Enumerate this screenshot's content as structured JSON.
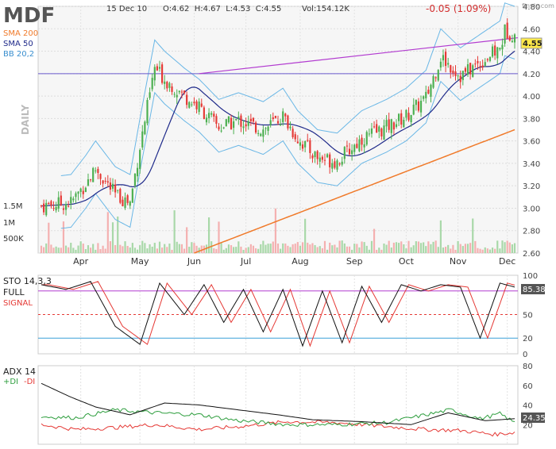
{
  "header": {
    "ticker": "MDF",
    "date": "15 Dec 10",
    "ohlc": "O:4.62  H:4.67  L:4.53  C:4.55",
    "volume": "Vol:154.12K",
    "change": "-0.05 (1.09%)",
    "brand": "finviz.com",
    "period": "DAILY"
  },
  "legend": {
    "sma200": "SMA 200",
    "sma50": "SMA 50",
    "bb": "BB 20,2"
  },
  "colors": {
    "up": "#4caf50",
    "down": "#e53935",
    "sma200": "#f07a2a",
    "sma50": "#1f2a8a",
    "bb": "#6ab7e6",
    "trend": "#b23bd0",
    "hline": "#6a5acd",
    "stoK": "#111111",
    "stoD": "#e53935",
    "adx": "#111111",
    "pdi": "#2e9e3e",
    "mdi": "#e53935"
  },
  "chart_data": [
    {
      "type": "candlestick",
      "title": "MDF",
      "months": [
        "Apr",
        "May",
        "Jun",
        "Jul",
        "Aug",
        "Sep",
        "Oct",
        "Nov",
        "Dec"
      ],
      "price_ticks": [
        2.6,
        2.8,
        3.0,
        3.2,
        3.4,
        3.6,
        3.8,
        4.0,
        4.2,
        4.4,
        4.6,
        4.8
      ],
      "ylim": [
        2.6,
        4.8
      ],
      "last_price": 4.55,
      "volume_ticks": [
        "1.5M",
        "1M",
        "500K"
      ],
      "close_path": [
        [
          0,
          3.02
        ],
        [
          12,
          3.05
        ],
        [
          18,
          3.22
        ],
        [
          22,
          3.35
        ],
        [
          30,
          3.12
        ],
        [
          36,
          3.05
        ],
        [
          40,
          3.55
        ],
        [
          46,
          4.25
        ],
        [
          50,
          4.15
        ],
        [
          58,
          4.0
        ],
        [
          64,
          3.9
        ],
        [
          72,
          3.72
        ],
        [
          80,
          3.78
        ],
        [
          90,
          3.7
        ],
        [
          98,
          3.82
        ],
        [
          104,
          3.62
        ],
        [
          112,
          3.45
        ],
        [
          120,
          3.42
        ],
        [
          130,
          3.62
        ],
        [
          140,
          3.72
        ],
        [
          148,
          3.82
        ],
        [
          156,
          3.98
        ],
        [
          162,
          4.35
        ],
        [
          170,
          4.18
        ],
        [
          178,
          4.3
        ],
        [
          186,
          4.42
        ],
        [
          188,
          4.58
        ],
        [
          192,
          4.55
        ]
      ],
      "sma200_endpoints": [
        [
          2.6,
          "Jun"
        ],
        [
          3.7,
          "Dec"
        ]
      ],
      "hline": 4.2
    },
    {
      "type": "line",
      "title": "STO 14,3,3",
      "labels": [
        "FULL",
        "SIGNAL"
      ],
      "y_ticks": [
        100,
        80,
        50,
        20,
        0
      ],
      "ylim": [
        0,
        100
      ],
      "last": "85.38",
      "k_path": [
        [
          0,
          88
        ],
        [
          10,
          82
        ],
        [
          20,
          92
        ],
        [
          30,
          35
        ],
        [
          40,
          12
        ],
        [
          48,
          90
        ],
        [
          58,
          50
        ],
        [
          66,
          88
        ],
        [
          74,
          40
        ],
        [
          82,
          82
        ],
        [
          90,
          28
        ],
        [
          98,
          82
        ],
        [
          106,
          10
        ],
        [
          114,
          80
        ],
        [
          122,
          14
        ],
        [
          130,
          86
        ],
        [
          138,
          40
        ],
        [
          146,
          88
        ],
        [
          154,
          80
        ],
        [
          162,
          88
        ],
        [
          170,
          85
        ],
        [
          178,
          20
        ],
        [
          186,
          90
        ],
        [
          192,
          85
        ]
      ]
    },
    {
      "type": "line",
      "title": "ADX 14",
      "labels": [
        "+DI",
        "-DI"
      ],
      "y_ticks": [
        80,
        60,
        40,
        20
      ],
      "ylim": [
        0,
        80
      ],
      "last": "24.35",
      "adx_path": [
        [
          0,
          62
        ],
        [
          12,
          48
        ],
        [
          22,
          38
        ],
        [
          36,
          30
        ],
        [
          50,
          42
        ],
        [
          64,
          40
        ],
        [
          80,
          35
        ],
        [
          96,
          30
        ],
        [
          110,
          25
        ],
        [
          130,
          23
        ],
        [
          150,
          20
        ],
        [
          165,
          32
        ],
        [
          180,
          24
        ],
        [
          192,
          26
        ]
      ],
      "pdi_path": [
        [
          0,
          28
        ],
        [
          14,
          27
        ],
        [
          30,
          35
        ],
        [
          46,
          32
        ],
        [
          64,
          30
        ],
        [
          80,
          24
        ],
        [
          100,
          20
        ],
        [
          120,
          20
        ],
        [
          140,
          22
        ],
        [
          156,
          30
        ],
        [
          166,
          35
        ],
        [
          178,
          26
        ],
        [
          186,
          31
        ],
        [
          192,
          22
        ]
      ],
      "mdi_path": [
        [
          0,
          20
        ],
        [
          14,
          15
        ],
        [
          30,
          17
        ],
        [
          46,
          20
        ],
        [
          64,
          15
        ],
        [
          80,
          18
        ],
        [
          100,
          23
        ],
        [
          120,
          22
        ],
        [
          140,
          18
        ],
        [
          156,
          15
        ],
        [
          170,
          14
        ],
        [
          184,
          10
        ],
        [
          192,
          12
        ]
      ]
    }
  ]
}
